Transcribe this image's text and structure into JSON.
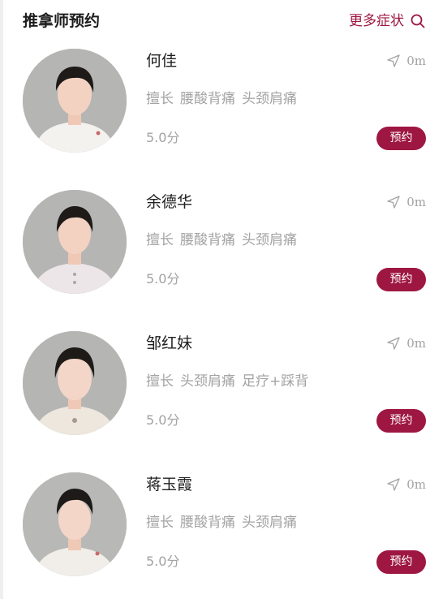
{
  "header": {
    "title": "推拿师预约",
    "more_label": "更多症状"
  },
  "therapists": [
    {
      "name": "何佳",
      "distance": "0m",
      "specialty_label": "擅长",
      "tags": [
        "腰酸背痛",
        "头颈肩痛"
      ],
      "score": "5.0分",
      "book_label": "预约"
    },
    {
      "name": "余德华",
      "distance": "0m",
      "specialty_label": "擅长",
      "tags": [
        "腰酸背痛",
        "头颈肩痛"
      ],
      "score": "5.0分",
      "book_label": "预约"
    },
    {
      "name": "邹红妹",
      "distance": "0m",
      "specialty_label": "擅长",
      "tags": [
        "头颈肩痛",
        "足疗+踩背"
      ],
      "score": "5.0分",
      "book_label": "预约"
    },
    {
      "name": "蒋玉霞",
      "distance": "0m",
      "specialty_label": "擅长",
      "tags": [
        "腰酸背痛",
        "头颈肩痛"
      ],
      "score": "5.0分",
      "book_label": "预约"
    }
  ],
  "icons": {
    "search": "search-icon",
    "distance": "navigation-arrow-icon"
  },
  "colors": {
    "accent": "#9e1742",
    "muted_text": "#a3a3a3",
    "title_text": "#1c1c1c"
  }
}
